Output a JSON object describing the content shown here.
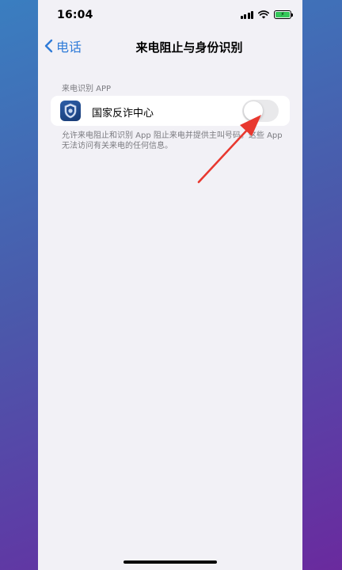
{
  "status_bar": {
    "time": "16:04",
    "battery_color": "#34c759"
  },
  "nav": {
    "back_label": "电话",
    "title": "来电阻止与身份识别"
  },
  "section": {
    "header": "来电识别 APP",
    "app": {
      "name": "国家反诈中心",
      "icon": "shield-badge-icon",
      "toggle_on": false
    },
    "footer": "允许来电阻止和识别 App 阻止来电并提供主叫号码。这些 App 无法访问有关来电的任何信息。"
  },
  "colors": {
    "accent": "#2f7bd8",
    "annotation_arrow": "#e8382f",
    "background": "#f2f1f6"
  }
}
